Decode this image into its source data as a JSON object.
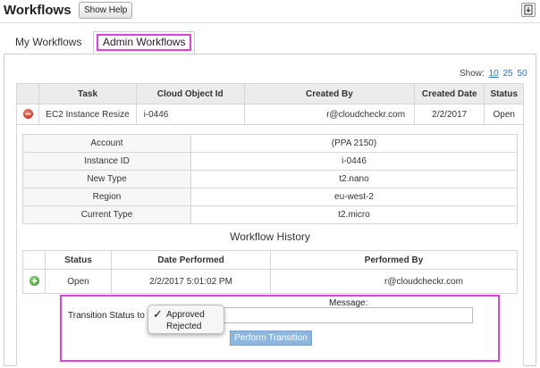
{
  "header": {
    "title": "Workflows",
    "help_button": "Show Help",
    "export_icon": "export-icon"
  },
  "tabs": [
    {
      "label": "My Workflows",
      "active": false
    },
    {
      "label": "Admin Workflows",
      "active": true
    }
  ],
  "pagination": {
    "label": "Show:",
    "options": [
      "10",
      "25",
      "50"
    ],
    "selected": "10"
  },
  "main_table": {
    "columns": [
      "",
      "Task",
      "Cloud Object Id",
      "Created By",
      "Created Date",
      "Status"
    ],
    "rows": [
      {
        "icon": "collapse-minus-icon",
        "task": "EC2 Instance Resize",
        "object_id": "i-0446",
        "created_by": "r@cloudcheckr.com",
        "created_date": "2/2/2017",
        "status": "Open"
      }
    ]
  },
  "details": [
    {
      "key": "Account",
      "value": "(PPA 2150)"
    },
    {
      "key": "Instance ID",
      "value": "i-0446"
    },
    {
      "key": "New Type",
      "value": "t2.nano"
    },
    {
      "key": "Region",
      "value": "eu-west-2"
    },
    {
      "key": "Current Type",
      "value": "t2.micro"
    }
  ],
  "history": {
    "title": "Workflow History",
    "columns": [
      "",
      "Status",
      "Date Performed",
      "Performed By"
    ],
    "rows": [
      {
        "icon": "expand-plus-icon",
        "status": "Open",
        "date": "2/2/2017 5:01:02 PM",
        "performed_by": "r@cloudcheckr.com"
      }
    ]
  },
  "transition": {
    "label": "Transition Status to",
    "options": [
      "Approved",
      "Rejected"
    ],
    "selected": "Approved",
    "message_label": "Message:",
    "message_value": "",
    "button": "Perform Transition"
  },
  "colors": {
    "highlight": "#e63ce0",
    "link": "#2a73c4",
    "button": "#8cb7e0"
  }
}
